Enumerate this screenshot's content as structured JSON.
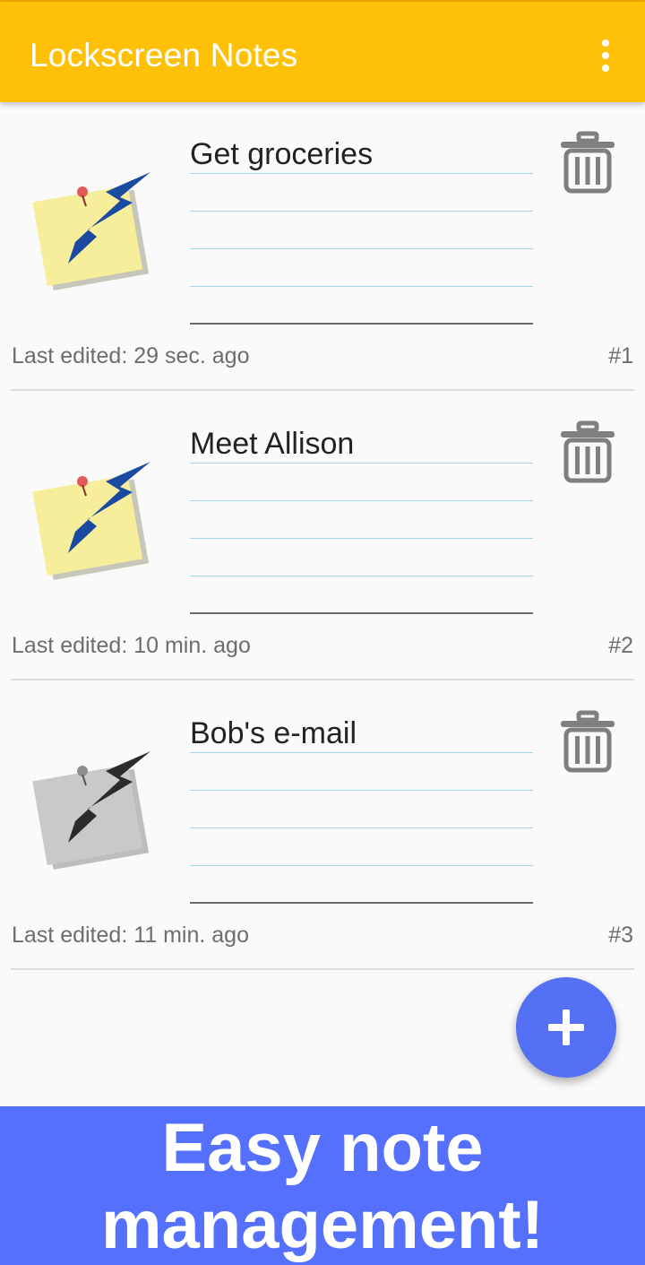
{
  "app_bar": {
    "title": "Lockscreen Notes",
    "menu_icon": "more-vert-icon",
    "background_color": "#ffc107"
  },
  "notes": [
    {
      "title": "Get groceries",
      "last_edited": "Last edited: 29 sec. ago",
      "number": "#1",
      "icon": "sticky-note-lightning-icon",
      "icon_style": "color",
      "active": true
    },
    {
      "title": "Meet Allison",
      "last_edited": "Last edited: 10 min. ago",
      "number": "#2",
      "icon": "sticky-note-lightning-icon",
      "icon_style": "color",
      "active": true
    },
    {
      "title": "Bob's e-mail",
      "last_edited": "Last edited: 11 min. ago",
      "number": "#3",
      "icon": "sticky-note-lightning-icon",
      "icon_style": "grayscale",
      "active": false
    }
  ],
  "delete_icon": "trash-icon",
  "fab": {
    "icon": "plus-icon",
    "color": "#5470f4"
  },
  "promo_banner": {
    "line1": "Easy note",
    "line2": "management!",
    "background_color": "#5470fc"
  }
}
